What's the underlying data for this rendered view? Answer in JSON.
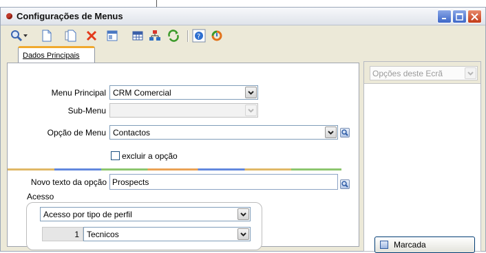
{
  "window": {
    "title": "Configurações de Menus"
  },
  "toolbar": {
    "icons": [
      "search-icon",
      "dropdown-arrow-icon",
      "new-document-icon",
      "copy-document-icon",
      "delete-icon",
      "properties-icon",
      "grid-icon",
      "tree-icon",
      "refresh-icon",
      "help-icon",
      "exit-icon"
    ]
  },
  "tabs": {
    "main": "Dados Principais"
  },
  "form": {
    "menu_principal_label": "Menu Principal",
    "menu_principal_value": "CRM Comercial",
    "sub_menu_label": "Sub-Menu",
    "sub_menu_value": "",
    "opcao_menu_label": "Opção de Menu",
    "opcao_menu_value": "Contactos",
    "excluir_label": "excluir a opção",
    "excluir_checked": false,
    "novo_texto_label": "Novo texto da opção",
    "novo_texto_value": "Prospects",
    "acesso_label": "Acesso",
    "acesso_tipo_value": "Acesso por tipo de perfil",
    "perfil_number": "1",
    "perfil_name": "Tecnicos"
  },
  "side_panel": {
    "options_placeholder": "Opções deste Ecrã",
    "marcada_label": "Marcada"
  },
  "colors": {
    "tab_accent": "#f0a92d",
    "close_button": "#c23b18",
    "window_bg": "#ece9d8"
  }
}
